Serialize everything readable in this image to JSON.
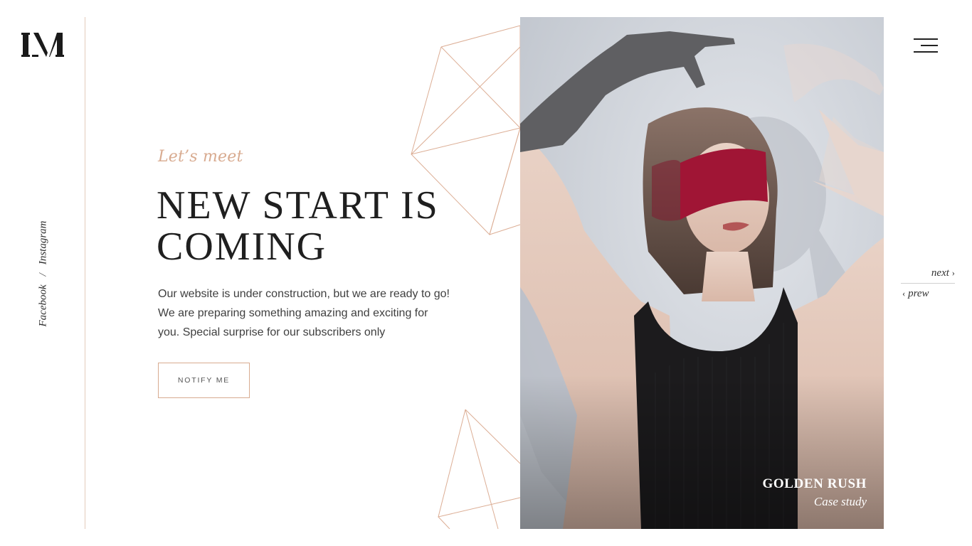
{
  "brand": {
    "logo_text": "IM"
  },
  "social": {
    "facebook": "Facebook",
    "separator": "/",
    "instagram": "Instagram"
  },
  "hero_text": {
    "kicker": "Let’s meet",
    "headline": "NEW START IS COMING",
    "description": "Our website is under construction, but we are ready to go! We are preparing something amazing and exciting for you. Special surprise for our subscribers only",
    "notify_label": "NOTIFY ME"
  },
  "feature": {
    "title": "GOLDEN RUSH",
    "subtitle": "Case study"
  },
  "pager": {
    "next": "next",
    "prev": "prew"
  },
  "colors": {
    "accent": "#d8ab90",
    "text": "#1f1f1f",
    "line": "#e3cbbc",
    "blindfold": "#a01535"
  },
  "icons": {
    "menu": "hamburger-menu-icon",
    "next": "chevron-right-icon",
    "prev": "chevron-left-icon"
  }
}
